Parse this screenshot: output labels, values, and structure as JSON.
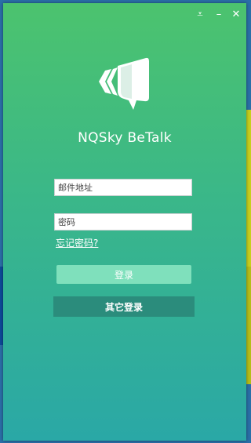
{
  "window": {
    "controls": {
      "menu_glyph": "⩡",
      "minimize_glyph": "–",
      "close_glyph": "✕"
    },
    "app_name": "NQSky BeTalk",
    "logo_icon": "chat-bubble-logo-icon"
  },
  "form": {
    "email_placeholder": "邮件地址",
    "password_placeholder": "密码",
    "forgot_password_label": "忘记密码?",
    "login_label": "登录",
    "other_login_label": "其它登录"
  },
  "colors": {
    "gradient_top": "#4cc36e",
    "gradient_bottom": "#2aa8a6",
    "login_button": "#7fe0bc",
    "other_login_button": "#2b8c7c"
  }
}
